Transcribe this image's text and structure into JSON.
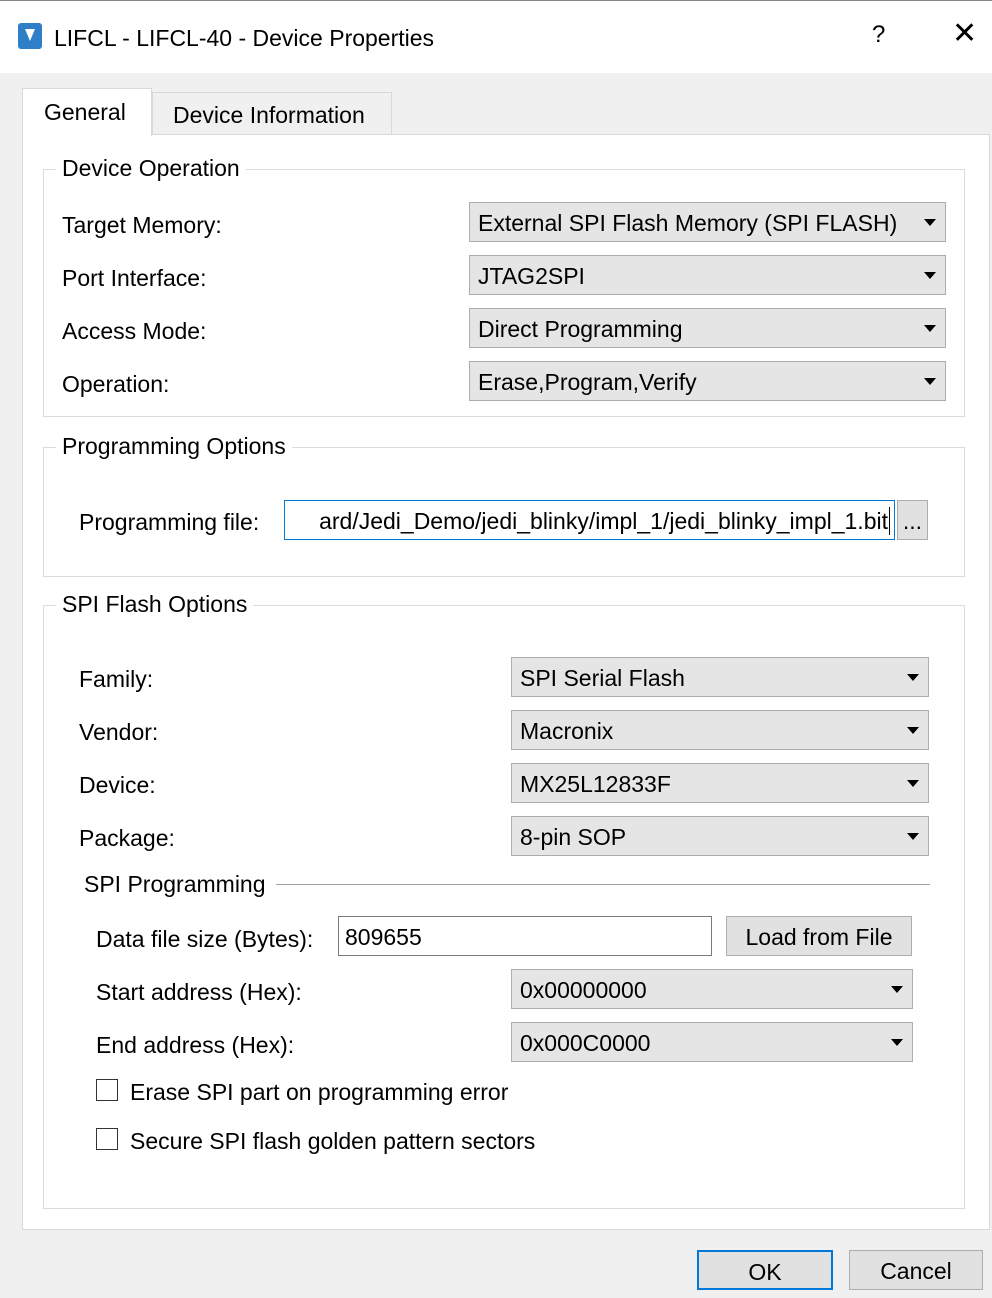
{
  "window": {
    "title": "LIFCL - LIFCL-40 - Device Properties",
    "help_label": "?",
    "close_label": "✕",
    "app_icon": "programmer-icon"
  },
  "tabs": [
    {
      "label": "General",
      "active": true
    },
    {
      "label": "Device Information",
      "active": false
    }
  ],
  "device_operation": {
    "title": "Device Operation",
    "target_memory": {
      "label": "Target Memory:",
      "value": "External SPI Flash Memory (SPI FLASH)"
    },
    "port_interface": {
      "label": "Port Interface:",
      "value": "JTAG2SPI"
    },
    "access_mode": {
      "label": "Access Mode:",
      "value": "Direct Programming"
    },
    "operation": {
      "label": "Operation:",
      "value": "Erase,Program,Verify"
    }
  },
  "programming_options": {
    "title": "Programming Options",
    "file_label": "Programming file:",
    "file_value": "ard/Jedi_Demo/jedi_blinky/impl_1/jedi_blinky_impl_1.bit",
    "browse_label": "..."
  },
  "spi_flash_options": {
    "title": "SPI Flash Options",
    "family": {
      "label": "Family:",
      "value": "SPI Serial Flash"
    },
    "vendor": {
      "label": "Vendor:",
      "value": "Macronix"
    },
    "device": {
      "label": "Device:",
      "value": "MX25L12833F"
    },
    "package": {
      "label": "Package:",
      "value": "8-pin SOP"
    },
    "spi_programming": {
      "title": "SPI Programming",
      "data_file_size": {
        "label": "Data file size (Bytes):",
        "value": "809655"
      },
      "load_from_file_label": "Load from File",
      "start_address": {
        "label": "Start address (Hex):",
        "value": "0x00000000"
      },
      "end_address": {
        "label": "End address (Hex):",
        "value": "0x000C0000"
      }
    },
    "erase_on_error": {
      "label": "Erase SPI part on programming error",
      "checked": false
    },
    "secure_golden": {
      "label": "Secure SPI flash golden pattern sectors",
      "checked": false
    }
  },
  "footer": {
    "ok_label": "OK",
    "cancel_label": "Cancel"
  },
  "colors": {
    "accent": "#0078d7",
    "window_bg": "#f0f0f0",
    "panel_bg": "#ffffff"
  }
}
